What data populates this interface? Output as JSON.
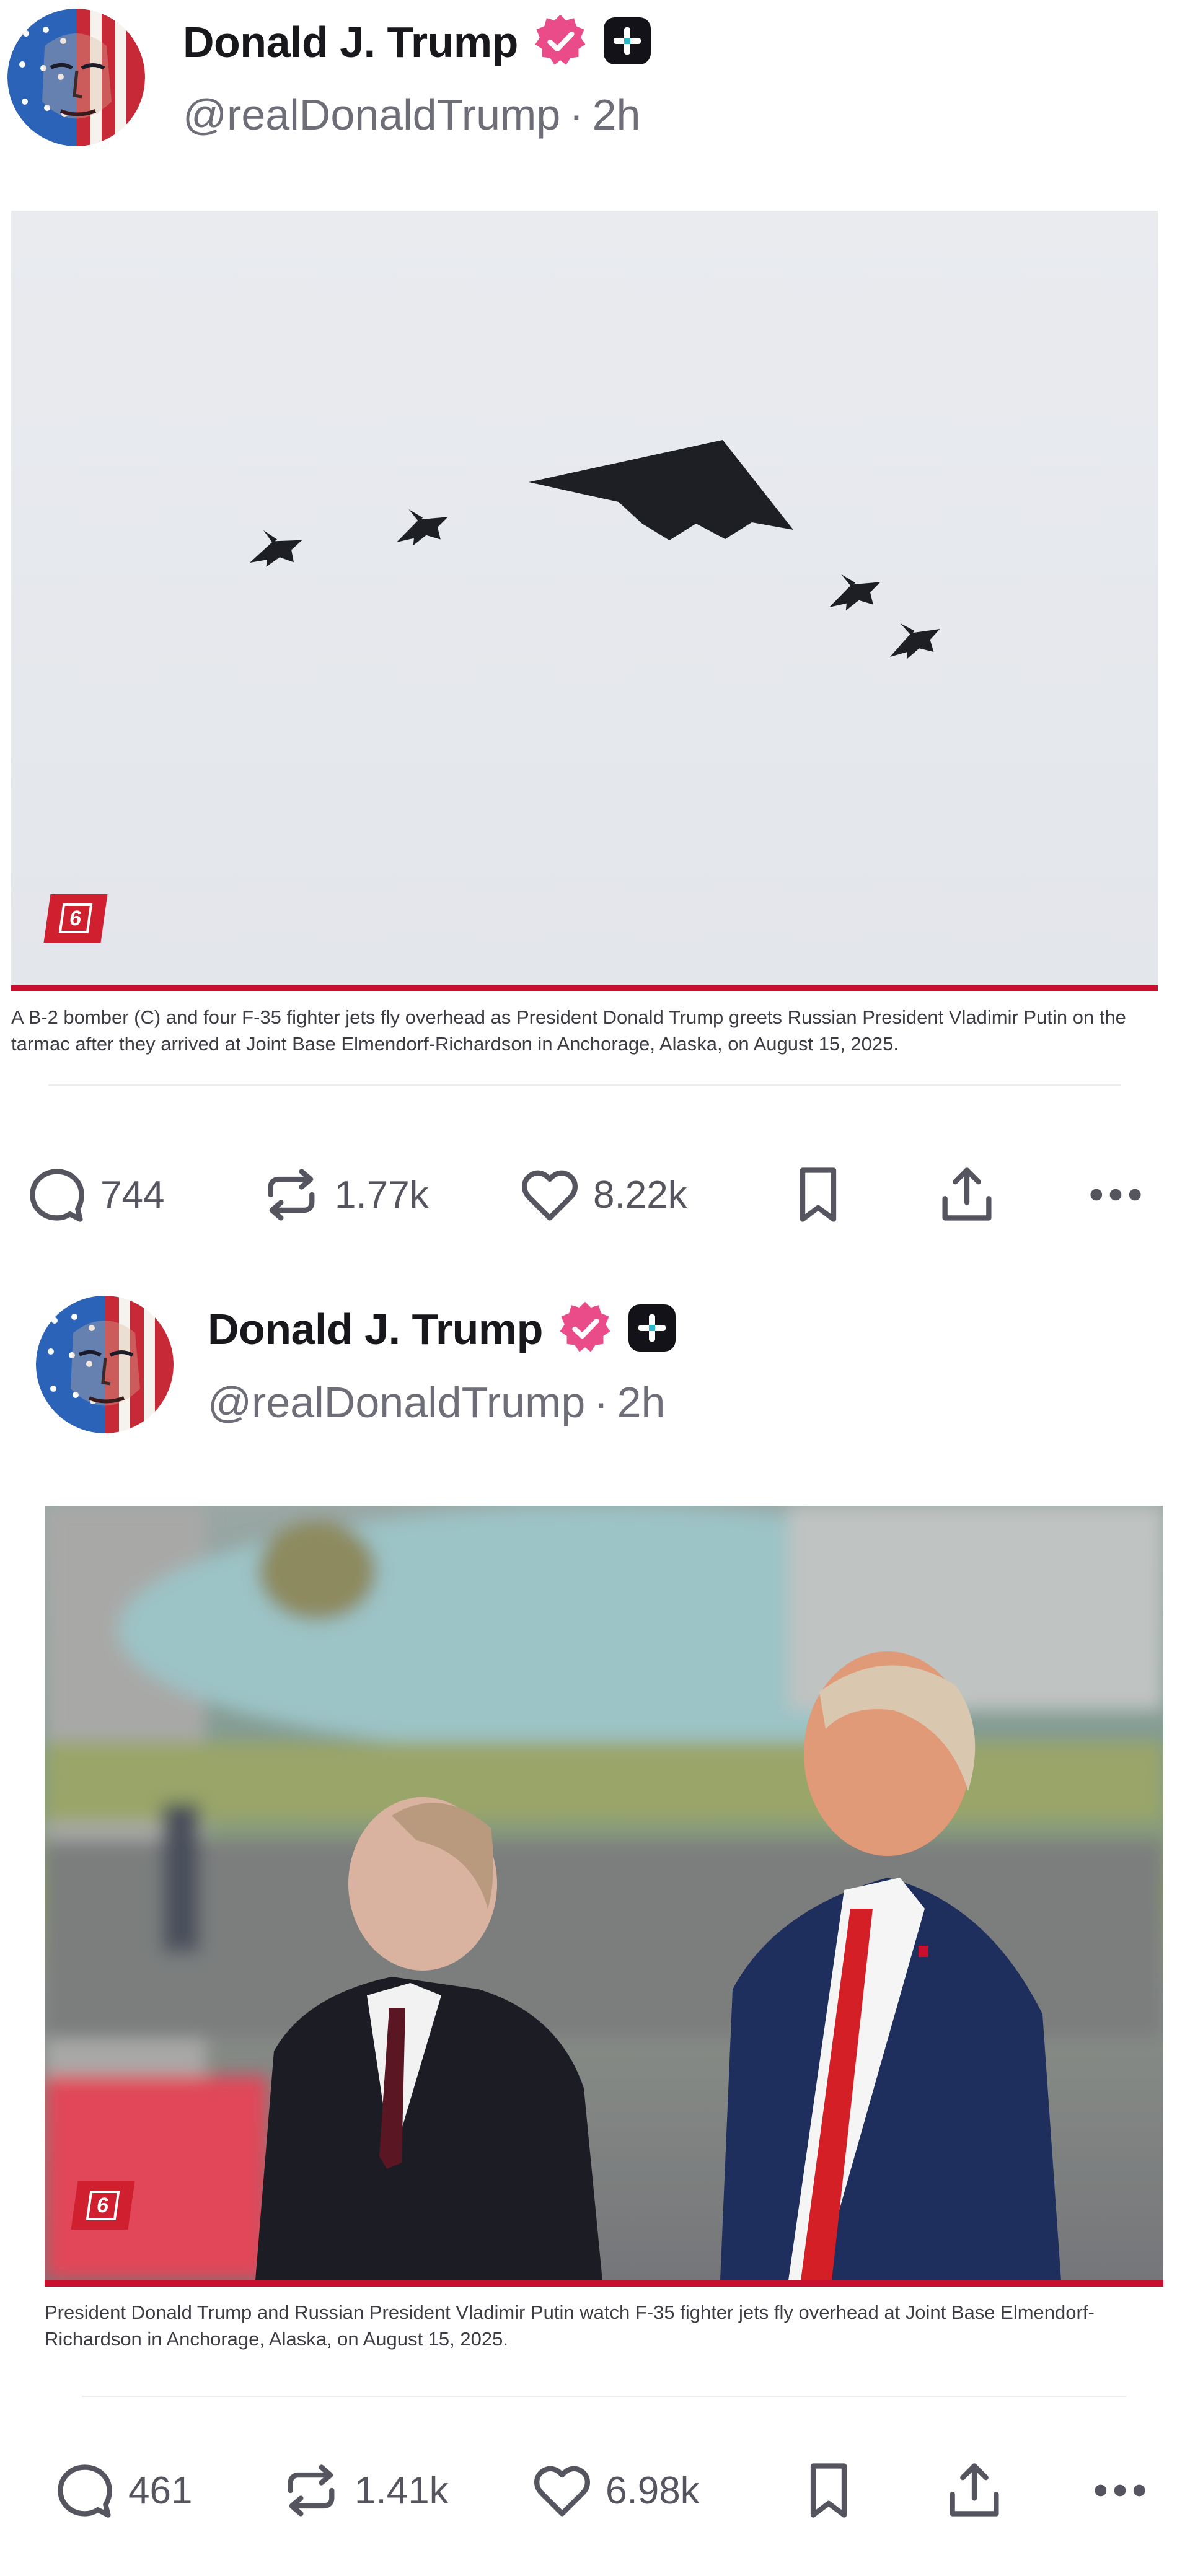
{
  "colors": {
    "accent_pink": "#ea4c89",
    "brand_red": "#c8102e",
    "text_primary": "#17171c",
    "text_secondary": "#6e6e78",
    "icon_gray": "#55555f"
  },
  "icons": {
    "verified": "verified-badge-icon",
    "plus": "plus-badge-icon",
    "reply": "reply-icon",
    "repost": "repost-icon",
    "like": "heart-icon",
    "bookmark": "bookmark-icon",
    "share": "share-icon",
    "more": "more-icon"
  },
  "posts": [
    {
      "author": {
        "name": "Donald J. Trump",
        "handle": "@realDonaldTrump",
        "time": "2h"
      },
      "media": {
        "logo": "6",
        "caption": "A B-2 bomber (C) and four F-35 fighter jets fly overhead as President Donald Trump greets Russian President Vladimir Putin on the tarmac after they arrived at Joint Base Elmendorf-Richardson in Anchorage, Alaska, on August 15, 2025."
      },
      "actions": {
        "replies": "744",
        "reposts": "1.77k",
        "likes": "8.22k"
      }
    },
    {
      "author": {
        "name": "Donald J. Trump",
        "handle": "@realDonaldTrump",
        "time": "2h"
      },
      "media": {
        "logo": "6",
        "caption": "President Donald Trump and Russian President Vladimir Putin watch F-35 fighter jets fly overhead at Joint Base Elmendorf-Richardson in Anchorage, Alaska, on August 15, 2025."
      },
      "actions": {
        "replies": "461",
        "reposts": "1.41k",
        "likes": "6.98k"
      }
    }
  ]
}
